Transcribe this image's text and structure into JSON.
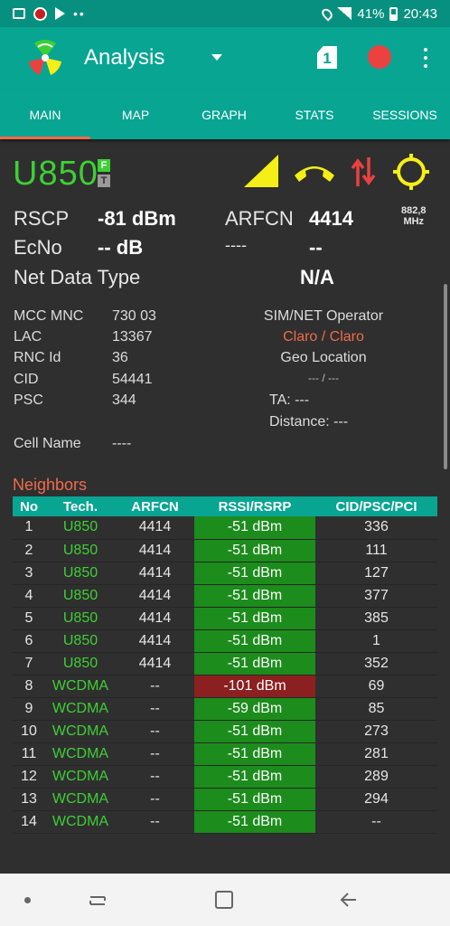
{
  "status_bar": {
    "battery": "41%",
    "time": "20:43",
    "dots": "••"
  },
  "app": {
    "title": "Analysis",
    "sim_slot": "1"
  },
  "tabs": [
    {
      "label": "MAIN",
      "active": true
    },
    {
      "label": "MAP"
    },
    {
      "label": "GRAPH"
    },
    {
      "label": "STATS"
    },
    {
      "label": "SESSIONS"
    }
  ],
  "serving": {
    "tech": "U850",
    "badge_f": "F",
    "badge_t": "T",
    "rscp_label": "RSCP",
    "rscp_value": "-81 dBm",
    "arfcn_label": "ARFCN",
    "arfcn_value": "4414",
    "freq_value": "882,8",
    "freq_unit": "MHz",
    "ecno_label": "EcNo",
    "ecno_value": "-- dB",
    "extra_label": "----",
    "extra_value": "--",
    "net_data_type_label": "Net Data Type",
    "net_data_type_value": "N/A"
  },
  "cell_info": {
    "mcc_mnc_label": "MCC MNC",
    "mcc_mnc_value": "730 03",
    "lac_label": "LAC",
    "lac_value": "13367",
    "rnc_label": "RNC Id",
    "rnc_value": "36",
    "cid_label": "CID",
    "cid_value": "54441",
    "psc_label": "PSC",
    "psc_value": "344",
    "cell_name_label": "Cell Name",
    "cell_name_value": "----",
    "operator_label": "SIM/NET Operator",
    "operator_value": "Claro / Claro",
    "geo_label": "Geo Location",
    "geo_value": "--- / ---",
    "ta_label": "TA: ---",
    "distance_label": "Distance: ---"
  },
  "neighbors": {
    "title": "Neighbors",
    "headers": [
      "No",
      "Tech.",
      "ARFCN",
      "RSSI/RSRP",
      "CID/PSC/PCI"
    ],
    "rows": [
      {
        "no": "1",
        "tech": "U850",
        "arfcn": "4414",
        "rssi": "-51 dBm",
        "id": "336",
        "quality": "good"
      },
      {
        "no": "2",
        "tech": "U850",
        "arfcn": "4414",
        "rssi": "-51 dBm",
        "id": "111",
        "quality": "good"
      },
      {
        "no": "3",
        "tech": "U850",
        "arfcn": "4414",
        "rssi": "-51 dBm",
        "id": "127",
        "quality": "good"
      },
      {
        "no": "4",
        "tech": "U850",
        "arfcn": "4414",
        "rssi": "-51 dBm",
        "id": "377",
        "quality": "good"
      },
      {
        "no": "5",
        "tech": "U850",
        "arfcn": "4414",
        "rssi": "-51 dBm",
        "id": "385",
        "quality": "good"
      },
      {
        "no": "6",
        "tech": "U850",
        "arfcn": "4414",
        "rssi": "-51 dBm",
        "id": "1",
        "quality": "good"
      },
      {
        "no": "7",
        "tech": "U850",
        "arfcn": "4414",
        "rssi": "-51 dBm",
        "id": "352",
        "quality": "good"
      },
      {
        "no": "8",
        "tech": "WCDMA",
        "arfcn": "--",
        "rssi": "-101 dBm",
        "id": "69",
        "quality": "bad"
      },
      {
        "no": "9",
        "tech": "WCDMA",
        "arfcn": "--",
        "rssi": "-59 dBm",
        "id": "85",
        "quality": "good"
      },
      {
        "no": "10",
        "tech": "WCDMA",
        "arfcn": "--",
        "rssi": "-51 dBm",
        "id": "273",
        "quality": "good"
      },
      {
        "no": "11",
        "tech": "WCDMA",
        "arfcn": "--",
        "rssi": "-51 dBm",
        "id": "281",
        "quality": "good"
      },
      {
        "no": "12",
        "tech": "WCDMA",
        "arfcn": "--",
        "rssi": "-51 dBm",
        "id": "289",
        "quality": "good"
      },
      {
        "no": "13",
        "tech": "WCDMA",
        "arfcn": "--",
        "rssi": "-51 dBm",
        "id": "294",
        "quality": "good"
      },
      {
        "no": "14",
        "tech": "WCDMA",
        "arfcn": "--",
        "rssi": "-51 dBm",
        "id": "--",
        "quality": "good"
      }
    ]
  },
  "colors": {
    "accent": "#08a593",
    "tech_green": "#3ecf35",
    "orange": "#f06a4a",
    "good_cell": "#1c8c1c",
    "bad_cell": "#8c1f1f",
    "signal_yellow": "#f5ee17",
    "record_red": "#ec4141"
  }
}
